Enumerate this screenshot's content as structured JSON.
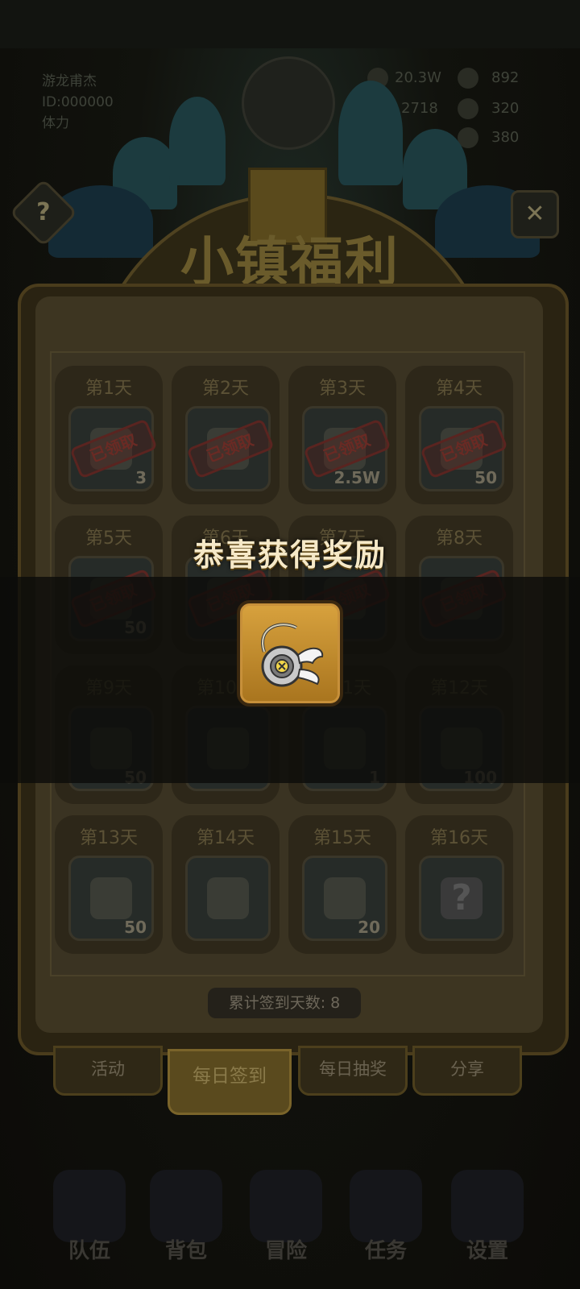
{
  "hud": {
    "player_name": "游龙甫杰",
    "player_id": "ID:000000",
    "stamina_label": "体力",
    "gold": "20.3W",
    "resource_2": "892",
    "resource_3": "2718",
    "resource_4": "320",
    "resource_5": "380"
  },
  "banner": {
    "title": "小镇福利"
  },
  "days": [
    {
      "label": "第1天",
      "qty": "3",
      "claimed": true,
      "icon": "blue-orb-icon"
    },
    {
      "label": "第2天",
      "qty": "",
      "claimed": true,
      "icon": "chest-icon"
    },
    {
      "label": "第3天",
      "qty": "2.5W",
      "claimed": true,
      "icon": "gold-coins-icon"
    },
    {
      "label": "第4天",
      "qty": "50",
      "claimed": true,
      "icon": "gem-box-icon"
    },
    {
      "label": "第5天",
      "qty": "50",
      "claimed": true,
      "icon": "crate-icon"
    },
    {
      "label": "第6天",
      "qty": "",
      "claimed": true,
      "icon": "scroll-icon"
    },
    {
      "label": "第7天",
      "qty": "",
      "claimed": true,
      "icon": "book-icon"
    },
    {
      "label": "第8天",
      "qty": "",
      "claimed": true,
      "icon": "pendant-icon"
    },
    {
      "label": "第9天",
      "qty": "50",
      "claimed": false,
      "icon": "cloth-icon"
    },
    {
      "label": "第10天",
      "qty": "",
      "claimed": false,
      "icon": "sword-icon"
    },
    {
      "label": "第11天",
      "qty": "1",
      "claimed": false,
      "icon": "feather-blade-icon"
    },
    {
      "label": "第12天",
      "qty": "100",
      "claimed": false,
      "icon": "ore-icon"
    },
    {
      "label": "第13天",
      "qty": "50",
      "claimed": false,
      "icon": "wood-log-icon"
    },
    {
      "label": "第14天",
      "qty": "",
      "claimed": false,
      "icon": "backpack-icon"
    },
    {
      "label": "第15天",
      "qty": "20",
      "claimed": false,
      "icon": "emblem-stone-icon"
    },
    {
      "label": "第16天",
      "qty": "",
      "claimed": false,
      "icon": "mystery-question-icon"
    }
  ],
  "claimed_stamp": "已领取",
  "counter_text": "累计签到天数: 8",
  "tabs": [
    "活动",
    "每日签到",
    "每日抽奖",
    "分享"
  ],
  "active_tab": 1,
  "bottom_nav": [
    "队伍",
    "背包",
    "冒险",
    "任务",
    "设置"
  ],
  "reward_popup": {
    "title": "恭喜获得奖励",
    "item_icon": "winged-pendant-icon"
  },
  "colors": {
    "reward_title": "#f6e9c8",
    "reward_frame": "#d8a23e"
  }
}
